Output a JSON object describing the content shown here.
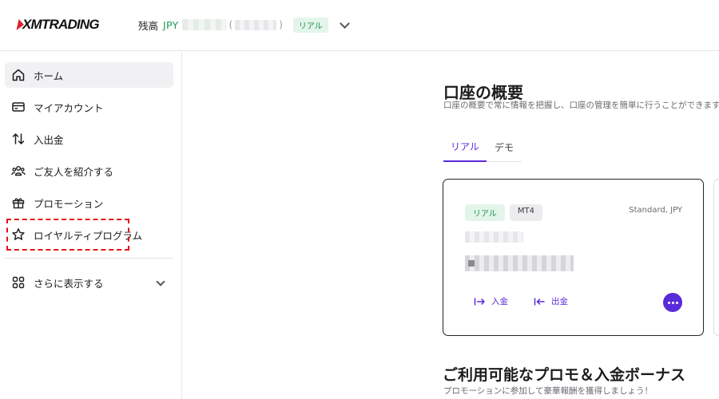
{
  "header": {
    "logo_text": "XMTRADING",
    "balance_label": "残高",
    "currency": "JPY",
    "paren_open": "(",
    "paren_close": ")",
    "account_badge": "リアル"
  },
  "sidebar": {
    "items": [
      {
        "label": "ホーム",
        "icon": "home-icon"
      },
      {
        "label": "マイアカウント",
        "icon": "card-icon"
      },
      {
        "label": "入出金",
        "icon": "transfer-arrows-icon"
      },
      {
        "label": "ご友人を紹介する",
        "icon": "users-icon"
      },
      {
        "label": "プロモーション",
        "icon": "gift-icon"
      },
      {
        "label": "ロイヤルティプログラム",
        "icon": "star-icon"
      }
    ],
    "more_label": "さらに表示する",
    "more_icon": "grid-icon"
  },
  "main": {
    "title": "口座の概要",
    "subtitle": "口座の概要で常に情報を把握し、口座の管理を簡単に行うことができます。",
    "tabs": [
      {
        "label": "リアル",
        "active": true
      },
      {
        "label": "デモ",
        "active": false
      }
    ],
    "card": {
      "badge_real": "リアル",
      "badge_platform": "MT4",
      "account_type": "Standard, JPY",
      "deposit_label": "入金",
      "withdraw_label": "出金"
    },
    "promo_title": "ご利用可能なプロモ＆入金ボーナス",
    "promo_subtitle": "プロモーションに参加して豪華報酬を獲得しましょう！"
  },
  "colors": {
    "accent": "#5a2bd8",
    "brand_red": "#d9232e",
    "positive_green": "#1e9b54",
    "highlight_red": "#e0121b"
  }
}
